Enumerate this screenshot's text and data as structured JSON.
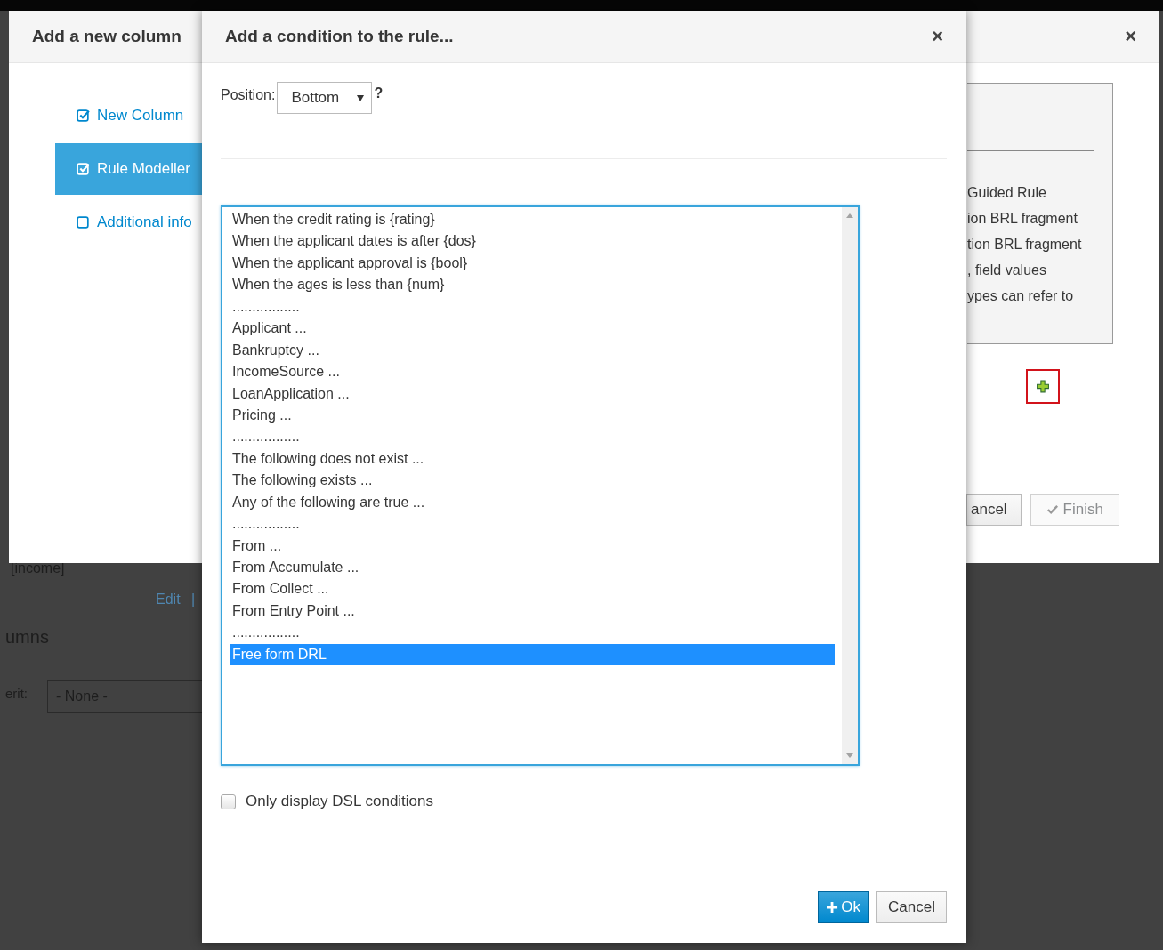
{
  "background_page": {
    "tag_text": "[income]",
    "edit_link": "Edit",
    "separator": "|",
    "heading": "umns",
    "field_label": "erit:",
    "field_value": "- None -"
  },
  "back_dialog": {
    "title": "Add a new column",
    "close": "×",
    "steps": [
      {
        "label": "New Column",
        "checked": true,
        "selected": false
      },
      {
        "label": "Rule Modeller",
        "checked": true,
        "selected": true
      },
      {
        "label": "Additional info",
        "checked": false,
        "selected": false
      }
    ],
    "info_lines": [
      "Guided Rule",
      "ion BRL fragment",
      "tion BRL fragment",
      ", field values",
      "ypes can refer to"
    ],
    "cancel_button": {
      "label": "ancel"
    },
    "finish_button": {
      "label": "Finish",
      "disabled": true
    }
  },
  "dialog": {
    "title": "Add a condition to the rule...",
    "close": "×",
    "position_label": "Position:",
    "position_select": "Bottom",
    "help": "?",
    "options": [
      {
        "text": "When the credit rating is {rating}",
        "selected": false
      },
      {
        "text": "When the applicant dates is after {dos}",
        "selected": false
      },
      {
        "text": "When the applicant approval is {bool}",
        "selected": false
      },
      {
        "text": "When the ages is less than {num}",
        "selected": false
      },
      {
        "text": ".................",
        "selected": false
      },
      {
        "text": "Applicant ...",
        "selected": false
      },
      {
        "text": "Bankruptcy ...",
        "selected": false
      },
      {
        "text": "IncomeSource ...",
        "selected": false
      },
      {
        "text": "LoanApplication ...",
        "selected": false
      },
      {
        "text": "Pricing ...",
        "selected": false
      },
      {
        "text": ".................",
        "selected": false
      },
      {
        "text": "The following does not exist ...",
        "selected": false
      },
      {
        "text": "The following exists ...",
        "selected": false
      },
      {
        "text": "Any of the following are true ...",
        "selected": false
      },
      {
        "text": ".................",
        "selected": false
      },
      {
        "text": "From ...",
        "selected": false
      },
      {
        "text": "From Accumulate ...",
        "selected": false
      },
      {
        "text": "From Collect ...",
        "selected": false
      },
      {
        "text": "From Entry Point ...",
        "selected": false
      },
      {
        "text": ".................",
        "selected": false
      },
      {
        "text": "Free form DRL",
        "selected": true
      }
    ],
    "dsl_only": {
      "label": "Only display DSL conditions",
      "checked": false
    },
    "ok_button": "Ok",
    "cancel_button": "Cancel"
  }
}
